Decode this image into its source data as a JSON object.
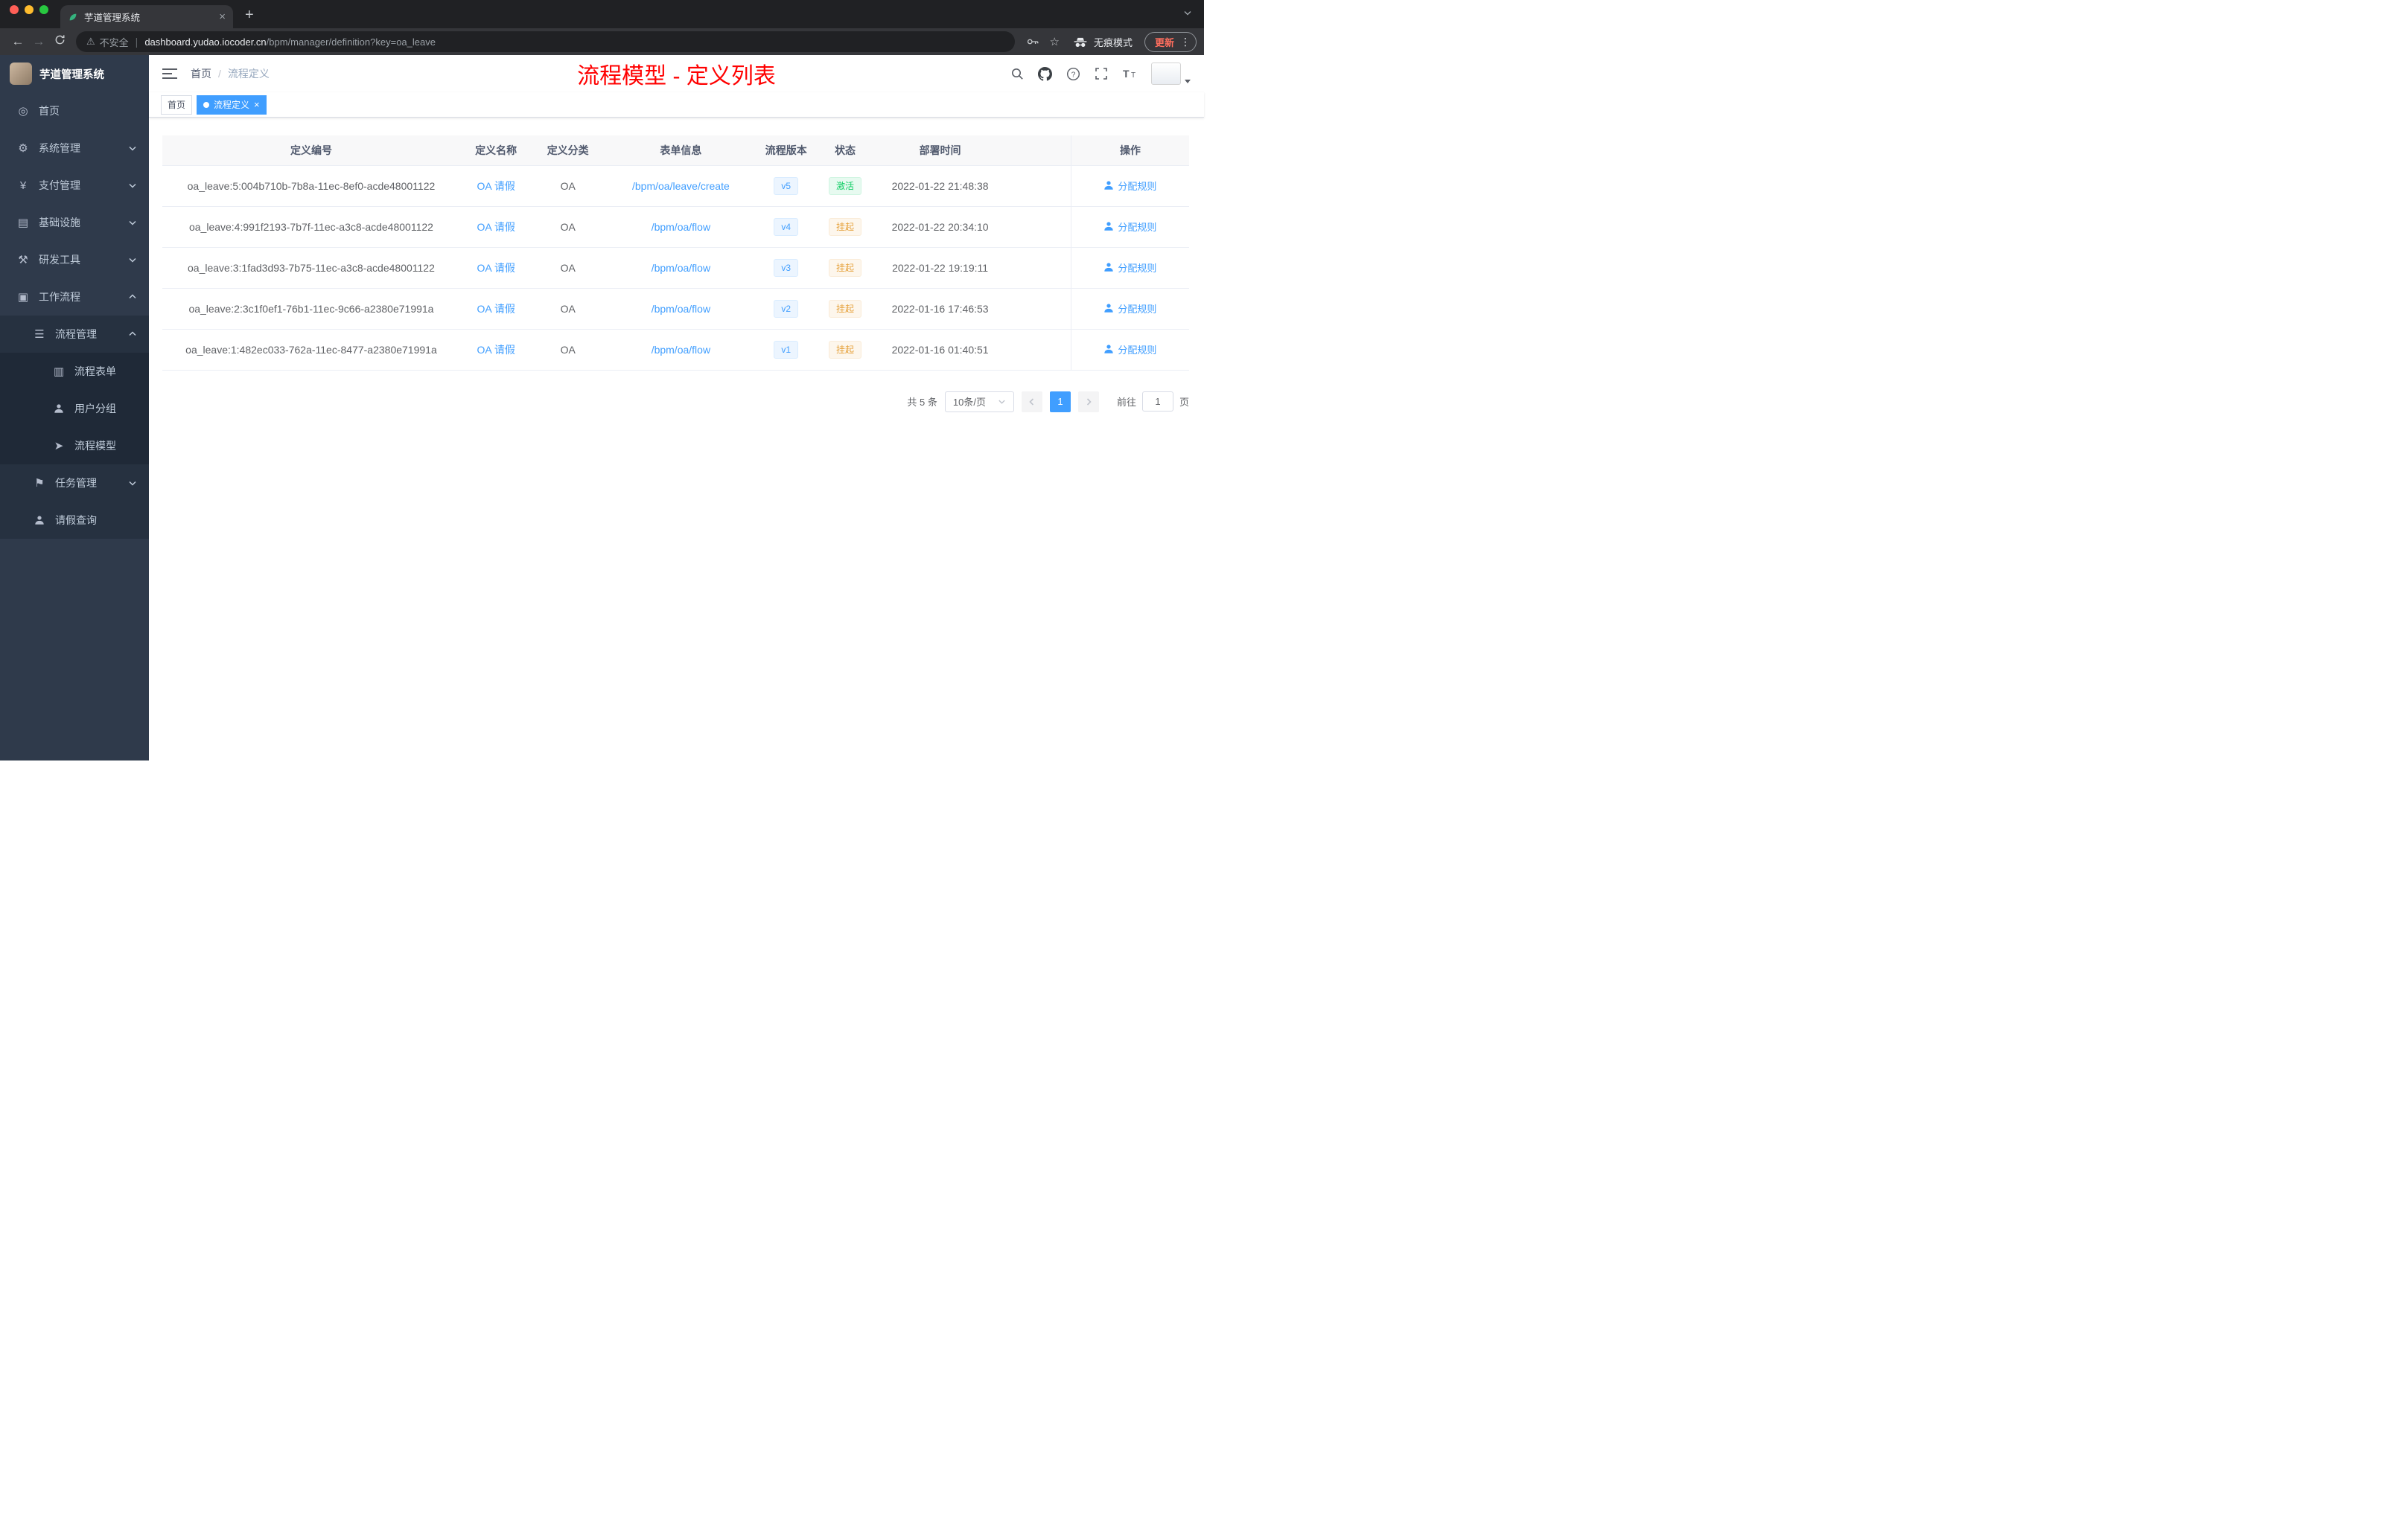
{
  "browser": {
    "tab_title": "芋道管理系统",
    "new_tab_button": "+",
    "security_label": "不安全",
    "url_domain": "dashboard.yudao.iocoder.cn",
    "url_path": "/bpm/manager/definition?key=oa_leave",
    "incognito_label": "无痕模式",
    "update_label": "更新"
  },
  "sidebar": {
    "logo_title": "芋道管理系统",
    "items": [
      {
        "key": "home",
        "label": "首页",
        "icon": "dashboard-icon",
        "level": 1
      },
      {
        "key": "system",
        "label": "系统管理",
        "icon": "gear-icon",
        "level": 1,
        "chevron": "down"
      },
      {
        "key": "payment",
        "label": "支付管理",
        "icon": "yen-icon",
        "level": 1,
        "chevron": "down"
      },
      {
        "key": "infrastructure",
        "label": "基础设施",
        "icon": "infra-icon",
        "level": 1,
        "chevron": "down"
      },
      {
        "key": "devtools",
        "label": "研发工具",
        "icon": "tools-icon",
        "level": 1,
        "chevron": "down"
      },
      {
        "key": "workflow",
        "label": "工作流程",
        "icon": "workflow-icon",
        "level": 1,
        "chevron": "up"
      },
      {
        "key": "process-mgmt",
        "label": "流程管理",
        "icon": "list-icon",
        "level": 2,
        "chevron": "up"
      },
      {
        "key": "process-form",
        "label": "流程表单",
        "icon": "form-icon",
        "level": 3
      },
      {
        "key": "user-group",
        "label": "用户分组",
        "icon": "users-icon",
        "level": 3
      },
      {
        "key": "process-model",
        "label": "流程模型",
        "icon": "send-icon",
        "level": 3
      },
      {
        "key": "task-mgmt",
        "label": "任务管理",
        "icon": "task-icon",
        "level": 2,
        "chevron": "down"
      },
      {
        "key": "leave-query",
        "label": "请假查询",
        "icon": "user-icon",
        "level": 2
      }
    ]
  },
  "navbar": {
    "breadcrumb": [
      "首页",
      "流程定义"
    ],
    "separator": "/",
    "annotation": "流程模型 - 定义列表"
  },
  "tags": [
    {
      "key": "home",
      "label": "首页",
      "active": false
    },
    {
      "key": "process-definition",
      "label": "流程定义",
      "active": true
    }
  ],
  "table": {
    "columns": [
      "定义编号",
      "定义名称",
      "定义分类",
      "表单信息",
      "流程版本",
      "状态",
      "部署时间",
      "操作"
    ],
    "action_label": "分配规则",
    "rows": [
      {
        "id": "oa_leave:5:004b710b-7b8a-11ec-8ef0-acde48001122",
        "name": "OA 请假",
        "category": "OA",
        "form": "/bpm/oa/leave/create",
        "version": "v5",
        "status": "激活",
        "status_type": "success",
        "deployed": "2022-01-22 21:48:38"
      },
      {
        "id": "oa_leave:4:991f2193-7b7f-11ec-a3c8-acde48001122",
        "name": "OA 请假",
        "category": "OA",
        "form": "/bpm/oa/flow",
        "version": "v4",
        "status": "挂起",
        "status_type": "warning",
        "deployed": "2022-01-22 20:34:10"
      },
      {
        "id": "oa_leave:3:1fad3d93-7b75-11ec-a3c8-acde48001122",
        "name": "OA 请假",
        "category": "OA",
        "form": "/bpm/oa/flow",
        "version": "v3",
        "status": "挂起",
        "status_type": "warning",
        "deployed": "2022-01-22 19:19:11"
      },
      {
        "id": "oa_leave:2:3c1f0ef1-76b1-11ec-9c66-a2380e71991a",
        "name": "OA 请假",
        "category": "OA",
        "form": "/bpm/oa/flow",
        "version": "v2",
        "status": "挂起",
        "status_type": "warning",
        "deployed": "2022-01-16 17:46:53"
      },
      {
        "id": "oa_leave:1:482ec033-762a-11ec-8477-a2380e71991a",
        "name": "OA 请假",
        "category": "OA",
        "form": "/bpm/oa/flow",
        "version": "v1",
        "status": "挂起",
        "status_type": "warning",
        "deployed": "2022-01-16 01:40:51"
      }
    ]
  },
  "pagination": {
    "total": "共 5 条",
    "page_size": "10条/页",
    "current_page": "1",
    "jump_prefix": "前往",
    "jump_value": "1",
    "jump_suffix": "页"
  },
  "colors": {
    "accent": "#409eff",
    "annotation_red": "#ff0000",
    "success": "#13ce66",
    "warning": "#e6a23c",
    "sidebar_bg": "#2f3a4b"
  }
}
